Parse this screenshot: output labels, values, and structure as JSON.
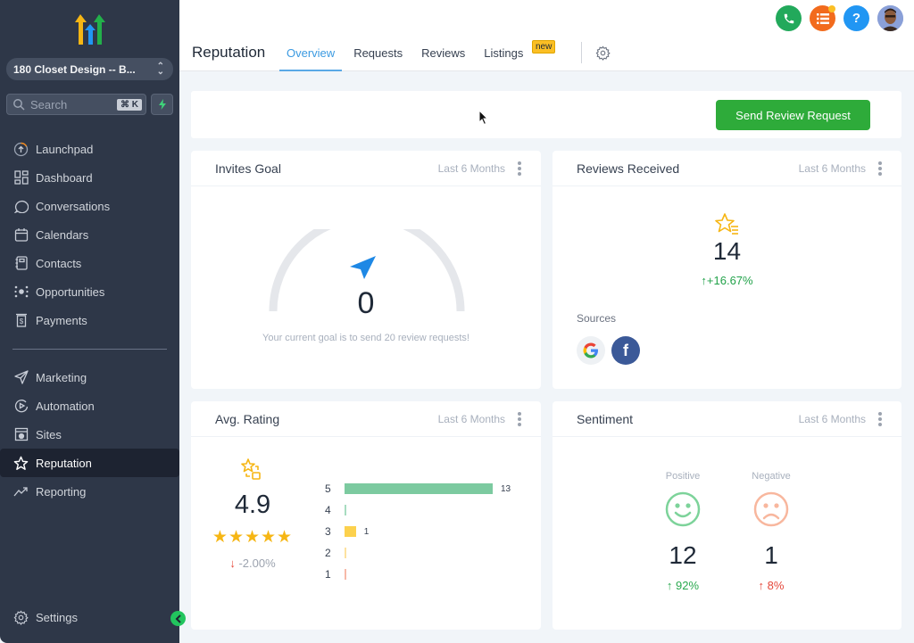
{
  "sidebar": {
    "location": "180 Closet Design -- B...",
    "search_placeholder": "Search",
    "search_shortcut": "⌘ K",
    "nav_primary": [
      {
        "label": "Launchpad",
        "icon": "launchpad-icon"
      },
      {
        "label": "Dashboard",
        "icon": "dashboard-icon"
      },
      {
        "label": "Conversations",
        "icon": "chat-bubble-icon"
      },
      {
        "label": "Calendars",
        "icon": "calendar-icon"
      },
      {
        "label": "Contacts",
        "icon": "contacts-book-icon"
      },
      {
        "label": "Opportunities",
        "icon": "opportunities-icon"
      },
      {
        "label": "Payments",
        "icon": "payments-icon"
      }
    ],
    "nav_secondary": [
      {
        "label": "Marketing",
        "icon": "send-icon"
      },
      {
        "label": "Automation",
        "icon": "automation-icon"
      },
      {
        "label": "Sites",
        "icon": "sites-icon"
      },
      {
        "label": "Reputation",
        "icon": "star-icon",
        "active": true
      },
      {
        "label": "Reporting",
        "icon": "trend-icon"
      }
    ],
    "settings_label": "Settings"
  },
  "header": {
    "title": "Reputation",
    "tabs": [
      {
        "label": "Overview",
        "active": true
      },
      {
        "label": "Requests"
      },
      {
        "label": "Reviews"
      },
      {
        "label": "Listings"
      }
    ],
    "new_badge": "new",
    "help_label": "?"
  },
  "actions": {
    "send_review_request": "Send Review Request"
  },
  "cards": {
    "invites_goal": {
      "title": "Invites Goal",
      "range": "Last 6 Months",
      "value": "0",
      "goal": 20,
      "progress": 0,
      "note": "Your current goal is to send 20 review requests!"
    },
    "reviews_received": {
      "title": "Reviews Received",
      "range": "Last 6 Months",
      "value": "14",
      "change": "+16.67%",
      "change_arrow": "↑",
      "sources_label": "Sources",
      "sources": [
        "Google",
        "Facebook"
      ]
    },
    "avg_rating": {
      "title": "Avg. Rating",
      "range": "Last 6 Months",
      "value": "4.9",
      "stars": "★★★★★",
      "change": "-2.00%",
      "change_arrow": "↓",
      "distribution": [
        {
          "stars": "5",
          "count": 13,
          "label": "13",
          "color": "#7ccaa0"
        },
        {
          "stars": "4",
          "count": 0,
          "label": "",
          "color": "#a7dcc0"
        },
        {
          "stars": "3",
          "count": 1,
          "label": "1",
          "color": "#fcd14d"
        },
        {
          "stars": "2",
          "count": 0,
          "label": "",
          "color": "#fde2a0"
        },
        {
          "stars": "1",
          "count": 0,
          "label": "",
          "color": "#f7b9a8"
        }
      ]
    },
    "sentiment": {
      "title": "Sentiment",
      "range": "Last 6 Months",
      "positive": {
        "label": "Positive",
        "value": "12",
        "change": "92%",
        "arrow": "↑",
        "color": "#7dd39a"
      },
      "negative": {
        "label": "Negative",
        "value": "1",
        "change": "8%",
        "arrow": "↑",
        "color": "#f8b79e"
      }
    }
  },
  "colors": {
    "brand_green": "#2eab3a",
    "accent_blue": "#3b9ae1",
    "sidebar_bg": "#2e3748",
    "star_gold": "#f6b614"
  }
}
